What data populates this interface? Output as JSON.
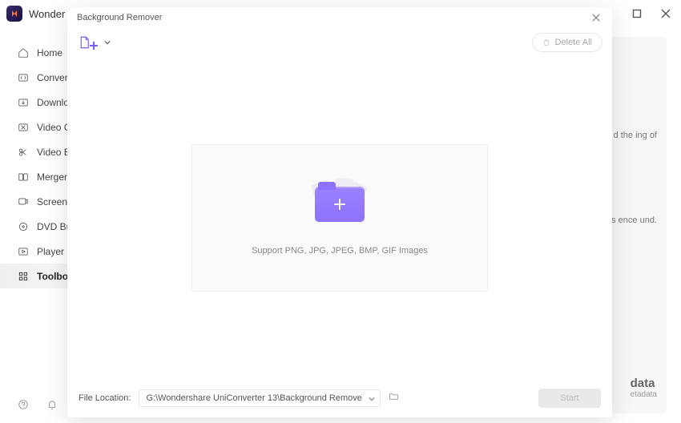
{
  "titlebar": {
    "brand": "Wonder"
  },
  "sidebar": {
    "items": [
      {
        "label": "Home"
      },
      {
        "label": "Converter"
      },
      {
        "label": "Downloader"
      },
      {
        "label": "Video Compressor"
      },
      {
        "label": "Video Editor"
      },
      {
        "label": "Merger"
      },
      {
        "label": "Screen Recorder"
      },
      {
        "label": "DVD Burner"
      },
      {
        "label": "Player"
      },
      {
        "label": "Toolbox"
      }
    ]
  },
  "right_panel": {
    "snip1": "d the ing of",
    "snip2": "aits ence und.",
    "data_title": "data",
    "data_sub": "etadata"
  },
  "modal": {
    "title": "Background Remover",
    "delete_all_label": "Delete All",
    "support_text": "Support PNG, JPG, JPEG, BMP, GIF Images",
    "file_location_label": "File Location:",
    "file_location_path": "G:\\Wondershare UniConverter 13\\Background Remove",
    "start_label": "Start"
  }
}
